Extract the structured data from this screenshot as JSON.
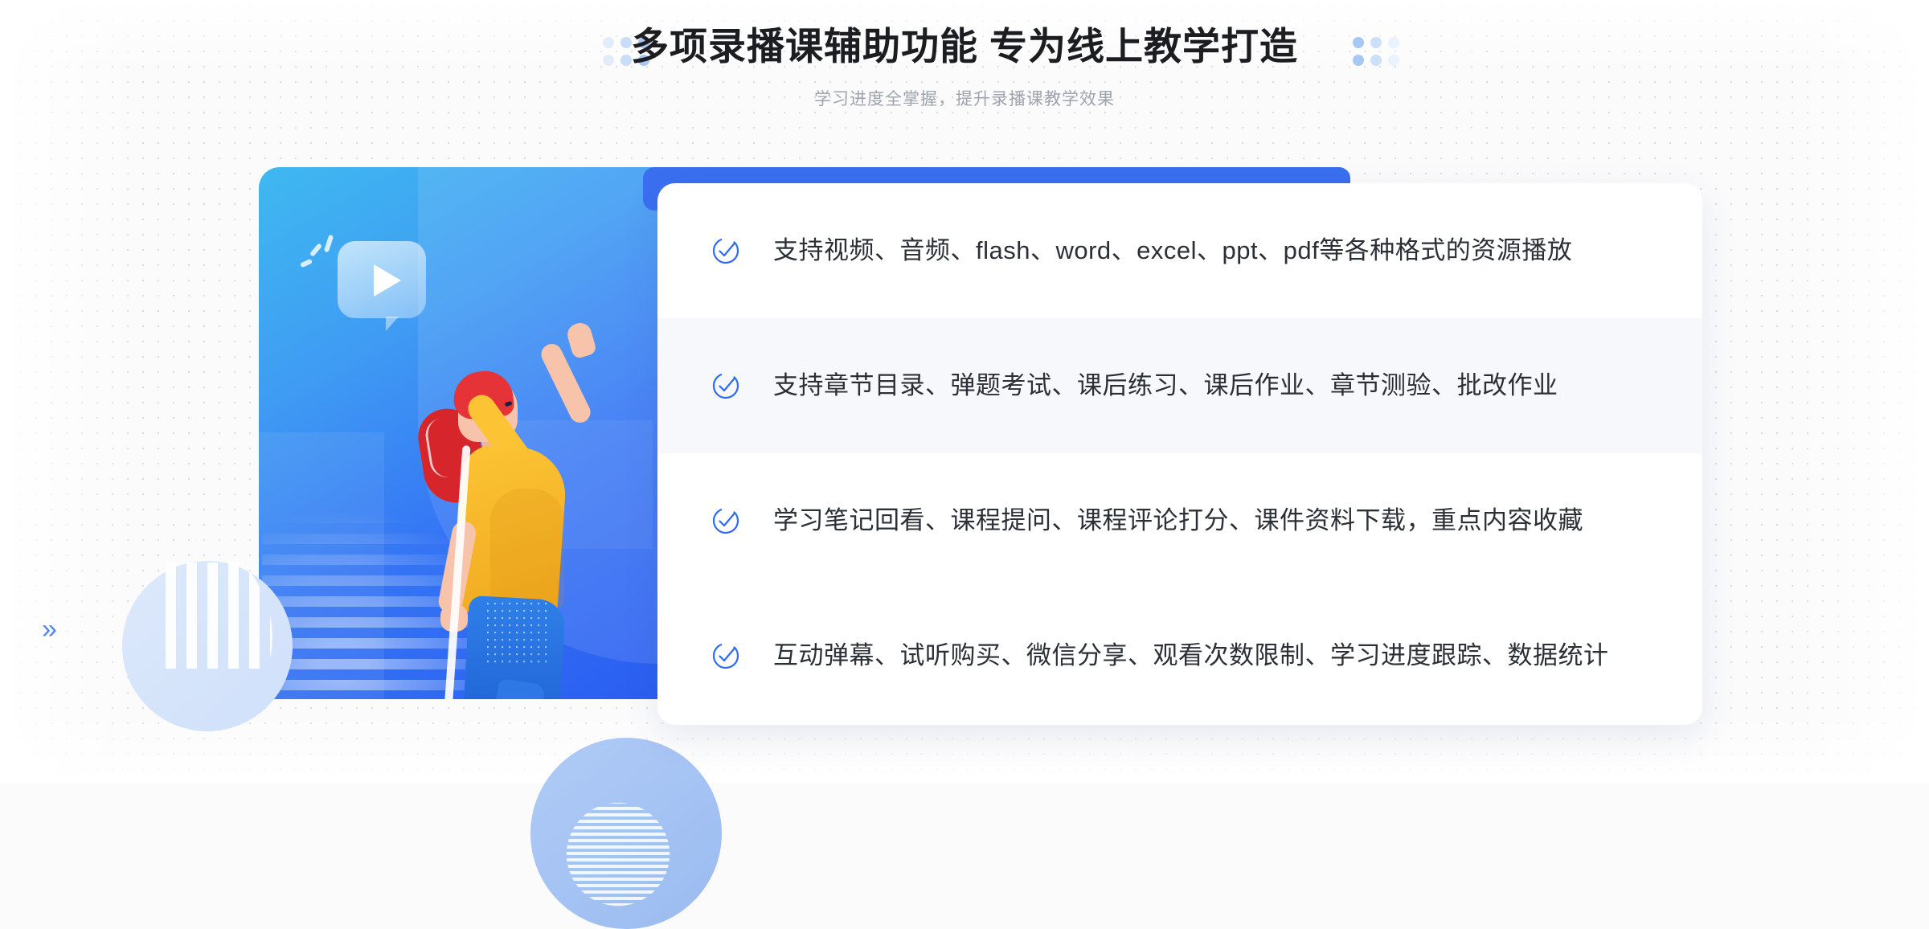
{
  "header": {
    "title": "多项录播课辅助功能 专为线上教学打造",
    "subtitle": "学习进度全掌握，提升录播课教学效果",
    "left_dots_icon": "dot-grid-icon",
    "right_dots_icon": "dot-grid-icon"
  },
  "illustration": {
    "play_icon": "play-bubble-icon",
    "person_alt": "woman-pointing-up-illustration",
    "chevron_inner_icon": "chevron-left-double-icon",
    "chevron_outer_icon": "chevron-right-double-icon",
    "circle_decor_icon": "circle-decoration"
  },
  "features": [
    {
      "icon": "check-circle-icon",
      "text": "支持视频、音频、flash、word、excel、ppt、pdf等各种格式的资源播放"
    },
    {
      "icon": "check-circle-icon",
      "text": "支持章节目录、弹题考试、课后练习、课后作业、章节测验、批改作业"
    },
    {
      "icon": "check-circle-icon",
      "text": "学习笔记回看、课程提问、课程评论打分、课件资料下载，重点内容收藏"
    },
    {
      "icon": "check-circle-icon",
      "text": "互动弹幕、试听购买、微信分享、观看次数限制、学习进度跟踪、数据统计"
    }
  ],
  "colors": {
    "accent_blue": "#2f6cf0",
    "check_blue": "#2e6bf0",
    "panel_cyan": "#3fb9f0",
    "panel_blue": "#2a5ef1",
    "bar_blue": "#3a6ff0",
    "title_text": "#1b1d21",
    "subtitle_text": "#9ea3ad",
    "body_text": "#2b2f36",
    "alt_row_bg": "#f7f8fb",
    "page_bg": "#fbfbfc",
    "shirt_yellow": "#fcc435",
    "hair_red": "#e53338",
    "pants_blue": "#2f7fe8"
  }
}
